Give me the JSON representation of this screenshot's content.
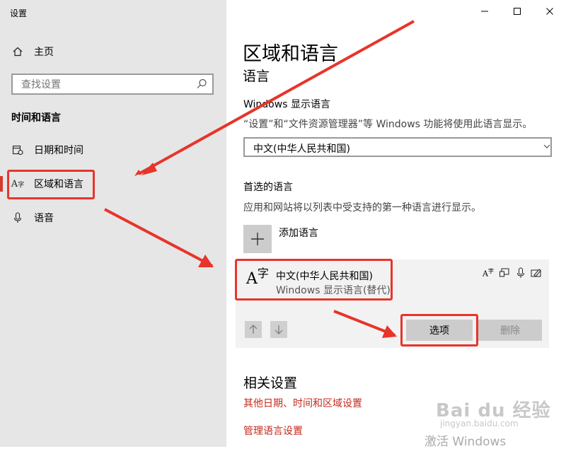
{
  "window": {
    "title": "设置"
  },
  "sidebar": {
    "home_label": "主页",
    "search_placeholder": "查找设置",
    "section_title": "时间和语言",
    "items": [
      {
        "label": "日期和时间"
      },
      {
        "label": "区域和语言"
      },
      {
        "label": "语音"
      }
    ]
  },
  "main": {
    "page_title": "区域和语言",
    "section_language": "语言",
    "display_language_label": "Windows 显示语言",
    "display_language_desc": "“设置”和“文件资源管理器”等 Windows 功能将使用此语言显示。",
    "display_language_value": "中文(中华人民共和国)",
    "preferred_label": "首选的语言",
    "preferred_desc": "应用和网站将以列表中受支持的第一种语言进行显示。",
    "add_language": "添加语言",
    "language_item": {
      "name": "中文(中华人民共和国)",
      "sub": "Windows 显示语言(替代)"
    },
    "options_button": "选项",
    "remove_button": "删除",
    "related_title": "相关设置",
    "links": [
      "其他日期、时间和区域设置",
      "管理语言设置"
    ]
  },
  "watermark": {
    "brand": "Bai du 经验",
    "site": "jingyan.baidu.com",
    "activate": "激活 Windows"
  },
  "colors": {
    "accent": "#d43a2e",
    "link": "#c42b1c",
    "annotation": "#e8342a",
    "sidebar_bg": "#e6e6e6"
  }
}
